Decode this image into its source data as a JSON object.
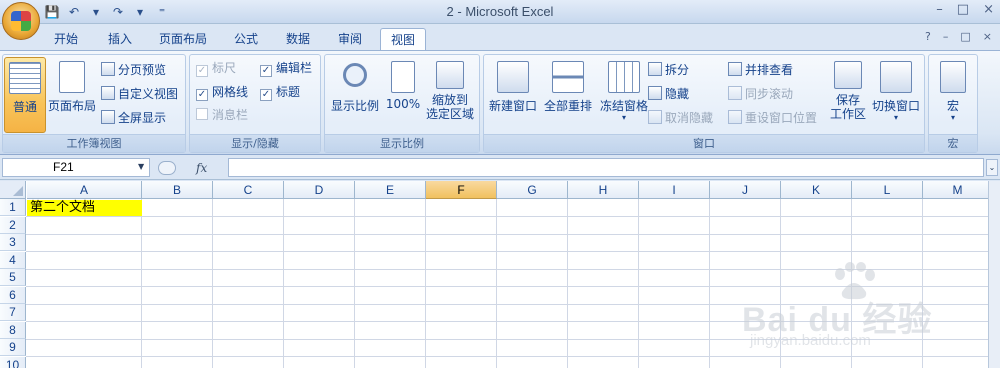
{
  "window": {
    "title": "2 - Microsoft Excel",
    "controls": [
      "–",
      "□",
      "×"
    ]
  },
  "quick_access": {
    "items": [
      {
        "name": "save-icon",
        "glyph": "💾"
      },
      {
        "name": "undo-icon",
        "glyph": "↶"
      },
      {
        "name": "dropdown-icon",
        "glyph": "▾"
      },
      {
        "name": "redo-icon",
        "glyph": "↷"
      },
      {
        "name": "dropdown-icon",
        "glyph": "▾"
      },
      {
        "name": "customize-icon",
        "glyph": "⁼"
      }
    ]
  },
  "tabs": [
    "开始",
    "插入",
    "页面布局",
    "公式",
    "数据",
    "审阅",
    "视图"
  ],
  "active_tab": "视图",
  "help_controls": [
    "?",
    "–",
    "□",
    "×"
  ],
  "ribbon": {
    "workbook_views": {
      "label": "工作簿视图",
      "normal": "普通",
      "page_layout": "页面布局",
      "page_break_preview": "分页预览",
      "custom_views": "自定义视图",
      "full_screen": "全屏显示"
    },
    "show_hide": {
      "label": "显示/隐藏",
      "ruler": "标尺",
      "gridlines": "网格线",
      "message_bar": "消息栏",
      "formula_bar": "编辑栏",
      "headings": "标题",
      "check": "✓"
    },
    "zoom": {
      "label": "显示比例",
      "zoom": "显示比例",
      "hundred": "100%",
      "zoom_to_selection_1": "缩放到",
      "zoom_to_selection_2": "选定区域"
    },
    "window": {
      "label": "窗口",
      "new_window": "新建窗口",
      "arrange_all": "全部重排",
      "freeze_panes": "冻结窗格",
      "split": "拆分",
      "hide": "隐藏",
      "unhide": "取消隐藏",
      "view_side_by_side": "并排查看",
      "sync_scroll": "同步滚动",
      "reset_position": "重设窗口位置",
      "save_workspace_1": "保存",
      "save_workspace_2": "工作区",
      "switch_windows": "切换窗口"
    },
    "macros": {
      "label": "宏",
      "macros": "宏"
    }
  },
  "formula_bar": {
    "name_box": "F21",
    "fx": "fx",
    "content": ""
  },
  "sheet": {
    "columns": [
      "A",
      "B",
      "C",
      "D",
      "E",
      "F",
      "G",
      "H",
      "I",
      "J",
      "K",
      "L",
      "M"
    ],
    "active_column": "F",
    "rows": [
      "1",
      "2",
      "3",
      "4",
      "5",
      "6",
      "7",
      "8",
      "9",
      "10"
    ],
    "cells": {
      "A1": "第二个文档"
    }
  },
  "watermark": {
    "text": "Bai du 经验",
    "sub": "jingyan.baidu.com"
  }
}
